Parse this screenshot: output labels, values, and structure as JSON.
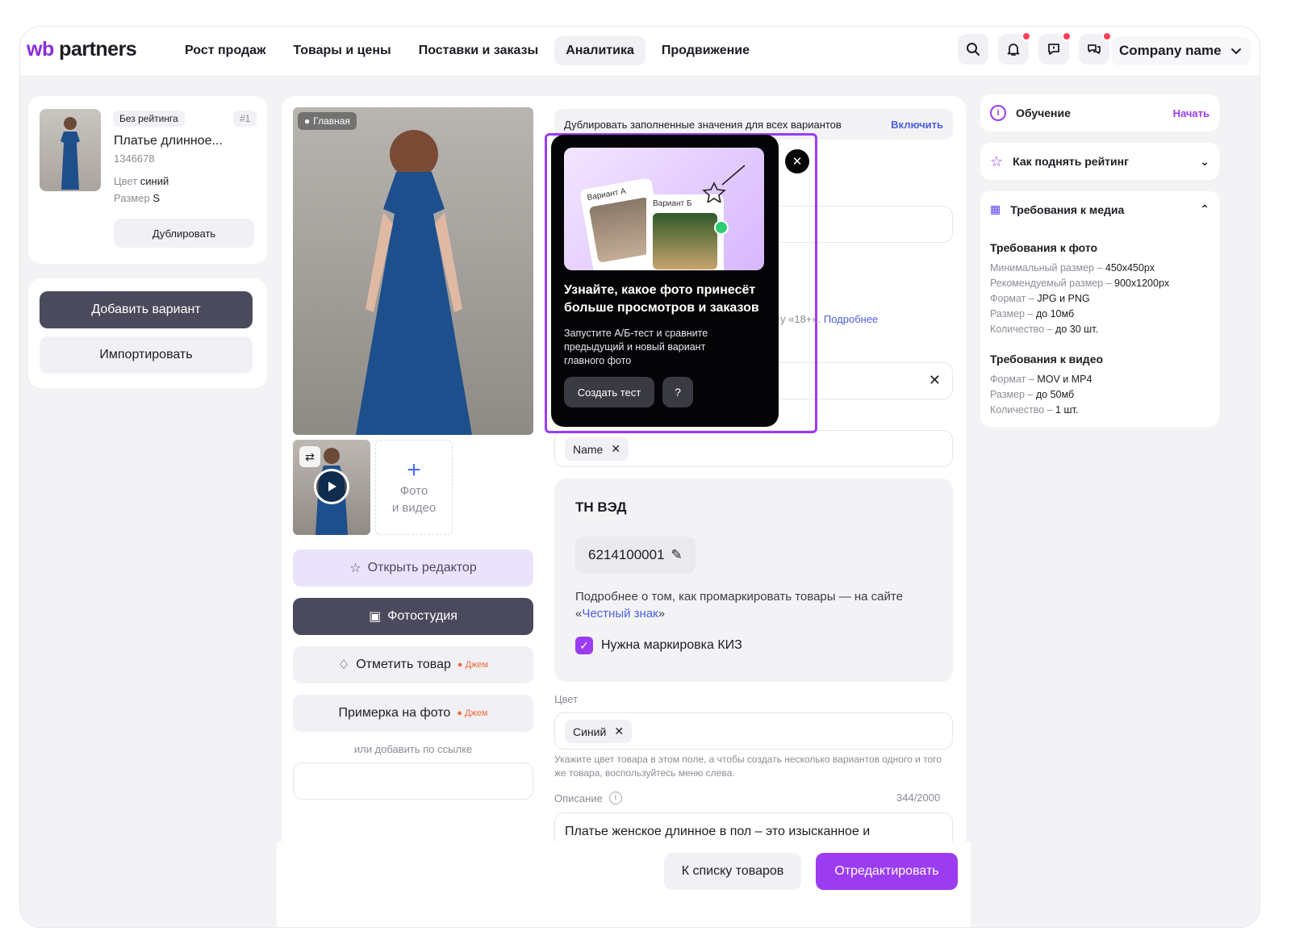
{
  "brand": {
    "wb": "wb",
    "partners": "partners",
    "accent": "#8a2bd9"
  },
  "nav": [
    {
      "label": "Рост продаж"
    },
    {
      "label": "Товары и цены"
    },
    {
      "label": "Поставки и заказы"
    },
    {
      "label": "Аналитика",
      "active": true
    },
    {
      "label": "Продвижение"
    }
  ],
  "header": {
    "company": "Company name",
    "icons": [
      "search-icon",
      "bell-icon",
      "chat-icon",
      "messages-icon"
    ]
  },
  "product": {
    "rating_badge": "Без рейтинга",
    "number": "#1",
    "title": "Платье длинное...",
    "sku": "1346678",
    "color_label": "Цвет",
    "color_value": "синий",
    "size_label": "Размер",
    "size_value": "S",
    "duplicate_btn": "Дублировать"
  },
  "variants": {
    "add_btn": "Добавить вариант",
    "import_btn": "Импортировать"
  },
  "media": {
    "main_badge": "Главная",
    "add_media_line1": "Фото",
    "add_media_line2": "и видео",
    "open_editor": "Открыть редактор",
    "photo_studio": "Фотостудия",
    "mark_product": "Отметить товар",
    "jam": "Джем",
    "try_on": "Примерка на фото",
    "jam2": "Джем",
    "or_link": "или добавить по ссылке"
  },
  "form": {
    "duplicate_values": "Дублировать заполненные значения для всех вариантов",
    "enable": "Включить",
    "age_hint": "у «18+». ",
    "more": "Подробнее",
    "name_chip": "Name",
    "tnved_title": "ТН ВЭД",
    "tnved_code": "6214100001",
    "marking_text_1": "Подробнее о том, как промаркировать товары — на сайте «",
    "marking_link": "Честный знак",
    "marking_text_2": "»",
    "marking_checkbox": "Нужна маркировка КИЗ",
    "color_label": "Цвет",
    "color_chip": "Синий",
    "color_hint": "Укажите цвет товара в этом поле, а чтобы создать несколько вариантов одного и того же товара, воспользуйтесь меню слева.",
    "description_label": "Описание",
    "description_count": "344/2000",
    "description_text": "Платье женское длинное в пол – это изысканное и"
  },
  "popover": {
    "variant_a": "Вариант А",
    "variant_b": "Вариант Б",
    "title": "Узнайте, какое фото принесёт больше просмотров и заказов",
    "text": "Запустите А/Б-тест и сравните предыдущий и новый вариант главного фото",
    "create_btn": "Создать тест"
  },
  "sidebar": {
    "learning": "Обучение",
    "start": "Начать",
    "raise_rating": "Как поднять рейтинг",
    "media_req": "Требования к медиа",
    "photo_req_title": "Требования к фото",
    "photo_req": [
      {
        "k": "Минимальный размер – ",
        "v": "450x450px"
      },
      {
        "k": "Рекомендуемый размер – ",
        "v": "900x1200px"
      },
      {
        "k": "Формат – ",
        "v": "JPG и PNG"
      },
      {
        "k": "Размер – ",
        "v": "до 10мб"
      },
      {
        "k": "Количество – ",
        "v": "до 30 шт."
      }
    ],
    "video_req_title": "Требования к видео",
    "video_req": [
      {
        "k": "Формат – ",
        "v": "MOV и MP4"
      },
      {
        "k": "Размер – ",
        "v": "до 50мб"
      },
      {
        "k": "Количество – ",
        "v": "1 шт."
      }
    ]
  },
  "footer": {
    "back_btn": "К списку товаров",
    "edit_btn": "Отредактировать"
  }
}
